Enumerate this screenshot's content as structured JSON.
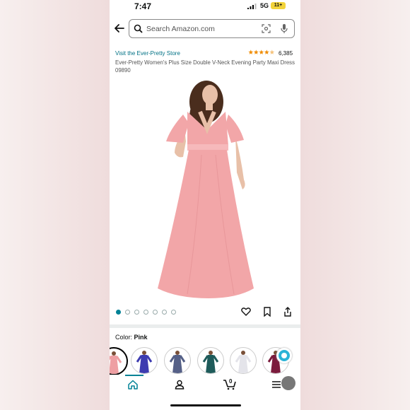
{
  "status": {
    "time": "7:47",
    "network": "5G",
    "battery": "11+"
  },
  "search": {
    "placeholder": "Search Amazon.com"
  },
  "product": {
    "store_link": "Visit the Ever-Pretty Store",
    "rating_count": "6,385",
    "rating_stars": 4.5,
    "title": "Ever-Pretty Women's Plus Size Double V-Neck Evening Party Maxi Dress 09890"
  },
  "gallery": {
    "total_images": 7,
    "active_index": 0
  },
  "actions": {
    "icons": [
      "heart-icon",
      "bookmark-icon",
      "share-icon"
    ]
  },
  "variants": {
    "label_prefix": "Color: ",
    "selected_color": "Pink",
    "swatch_colors": [
      "#ee9fa3",
      "#3d3bb0",
      "#556087",
      "#1e5b5a",
      "#e4e4ea",
      "#7b1b3c"
    ]
  },
  "bottom_nav": {
    "items": [
      "home-icon",
      "account-icon",
      "cart-icon",
      "menu-icon"
    ],
    "cart_count": "0",
    "active": "home"
  },
  "colors": {
    "link": "#007185",
    "accent": "#008296",
    "star": "#f08c00",
    "dress": "#f2a6a8"
  }
}
